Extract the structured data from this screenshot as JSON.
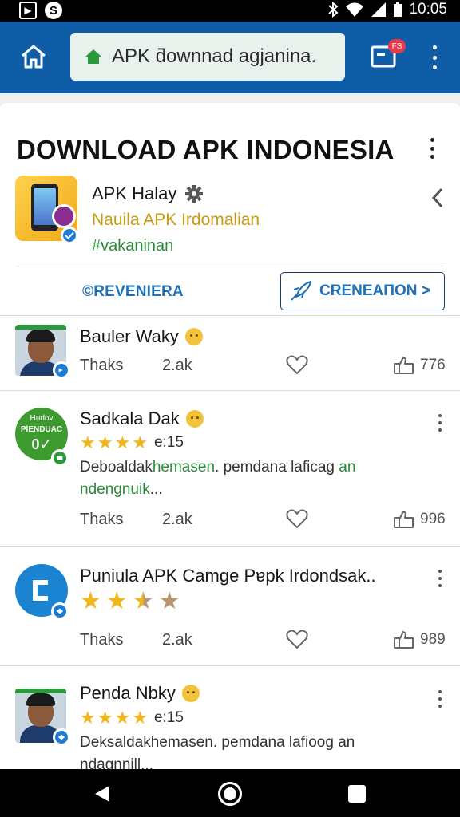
{
  "status_bar": {
    "time": "10:05",
    "left_icons": [
      "image-icon",
      "s-app-icon"
    ],
    "right_icons": [
      "bluetooth-icon",
      "wifi-icon",
      "signal-icon",
      "battery-icon"
    ]
  },
  "toolbar": {
    "url_text": "APK ƌownnad agjanina.",
    "tabs_badge": "FS",
    "accent_color": "#0f5ca7"
  },
  "page": {
    "title": "DOWNLOAD APK INDONESIA"
  },
  "app_header": {
    "name": "APK Halay",
    "subtitle": "Nauila APK Irdomalian",
    "tag": "#vakaninan",
    "link_button": "©REVENIERA",
    "outline_button": "CRENEAΠON >"
  },
  "feed": [
    {
      "title": "Bauler Waky",
      "thanks_label": "Thaks",
      "count_a": "2.ak",
      "count_b": "776"
    },
    {
      "title": "Sadkala Dak",
      "avatar_text_1": "Hudov",
      "avatar_text_2": "PlENDUAC",
      "avatar_text_3": "0✓",
      "rating": 4,
      "rating_text": "e:15",
      "desc_part1": "Deboaldak",
      "desc_part2": "hemasen",
      "desc_part3": ". pemdana laficag",
      "desc_part4": " an",
      "desc_part5": "ndengnuik",
      "desc_part6": "...",
      "thanks_label": "Thaks",
      "count_a": "2.ak",
      "count_b": "996"
    },
    {
      "title": "Puniula APK Camge Pɐpk Irdondsak..",
      "rating": 2.5,
      "thanks_label": "Thaks",
      "count_a": "2.ak",
      "count_b": "989"
    },
    {
      "title": "Penda Nbky",
      "rating": 4,
      "rating_text": "e:15",
      "desc": "Deksaldakhemasen. pemdana lafioog an",
      "desc2": "ndagnnill..."
    }
  ]
}
